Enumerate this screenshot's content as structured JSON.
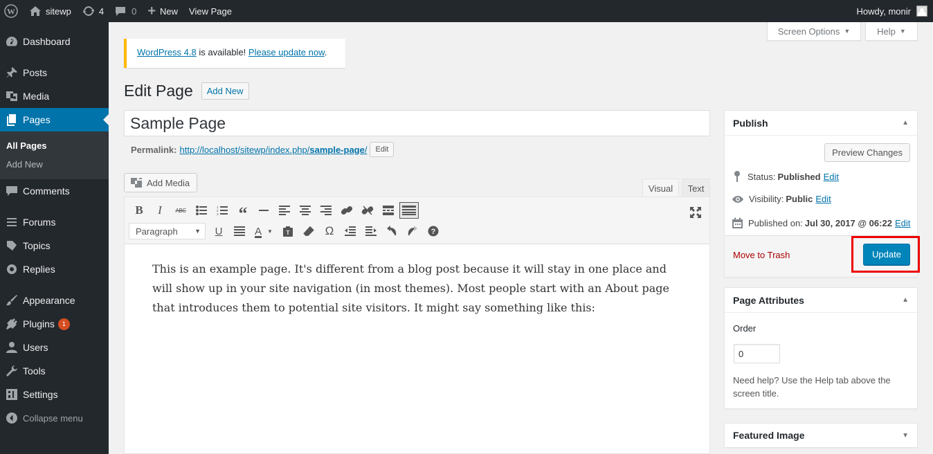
{
  "adminbar": {
    "site_name": "sitewp",
    "updates_count": "4",
    "comments_count": "0",
    "new_label": "New",
    "view_page_label": "View Page",
    "howdy_label": "Howdy, monir"
  },
  "sidebar": {
    "items": [
      {
        "label": "Dashboard",
        "icon": "dashboard-icon"
      },
      {
        "label": "Posts",
        "icon": "pin-icon"
      },
      {
        "label": "Media",
        "icon": "media-icon"
      },
      {
        "label": "Pages",
        "icon": "pages-icon"
      },
      {
        "label": "Comments",
        "icon": "comment-icon"
      },
      {
        "label": "Forums",
        "icon": "forums-icon"
      },
      {
        "label": "Topics",
        "icon": "topics-icon"
      },
      {
        "label": "Replies",
        "icon": "replies-icon"
      },
      {
        "label": "Appearance",
        "icon": "brush-icon"
      },
      {
        "label": "Plugins",
        "icon": "plug-icon",
        "badge": "1"
      },
      {
        "label": "Users",
        "icon": "user-icon"
      },
      {
        "label": "Tools",
        "icon": "wrench-icon"
      },
      {
        "label": "Settings",
        "icon": "settings-icon"
      }
    ],
    "submenu": [
      "All Pages",
      "Add New"
    ],
    "collapse_label": "Collapse menu"
  },
  "screen_meta": {
    "screen_options": "Screen Options",
    "help": "Help"
  },
  "notice": {
    "version_link": "WordPress 4.8",
    "middle_text": " is available! ",
    "update_link": "Please update now",
    "end": "."
  },
  "heading": {
    "title": "Edit Page",
    "add_new": "Add New"
  },
  "title_value": "Sample Page",
  "permalink": {
    "label": "Permalink:",
    "base": "http://localhost/sitewp/index.php/",
    "slug": "sample-page",
    "trail": "/",
    "edit": "Edit"
  },
  "editor": {
    "add_media": "Add Media",
    "tab_visual": "Visual",
    "tab_text": "Text",
    "format_value": "Paragraph",
    "content": "This is an example page. It's different from a blog post because it will stay in one place and will show up in your site navigation (in most themes). Most people start with an About page that introduces them to potential site visitors. It might say something like this:"
  },
  "publish": {
    "title": "Publish",
    "preview": "Preview Changes",
    "status_label": "Status:",
    "status_value": "Published",
    "visibility_label": "Visibility:",
    "visibility_value": "Public",
    "published_label": "Published on:",
    "published_value": "Jul 30, 2017 @ 06:22",
    "edit": "Edit",
    "trash": "Move to Trash",
    "update": "Update"
  },
  "page_attributes": {
    "title": "Page Attributes",
    "order_label": "Order",
    "order_value": "0",
    "help": "Need help? Use the Help tab above the screen title."
  },
  "featured_image": {
    "title": "Featured Image"
  },
  "colors": {
    "accent": "#0073aa",
    "highlight": "#e00000",
    "notice": "#ffb900"
  }
}
